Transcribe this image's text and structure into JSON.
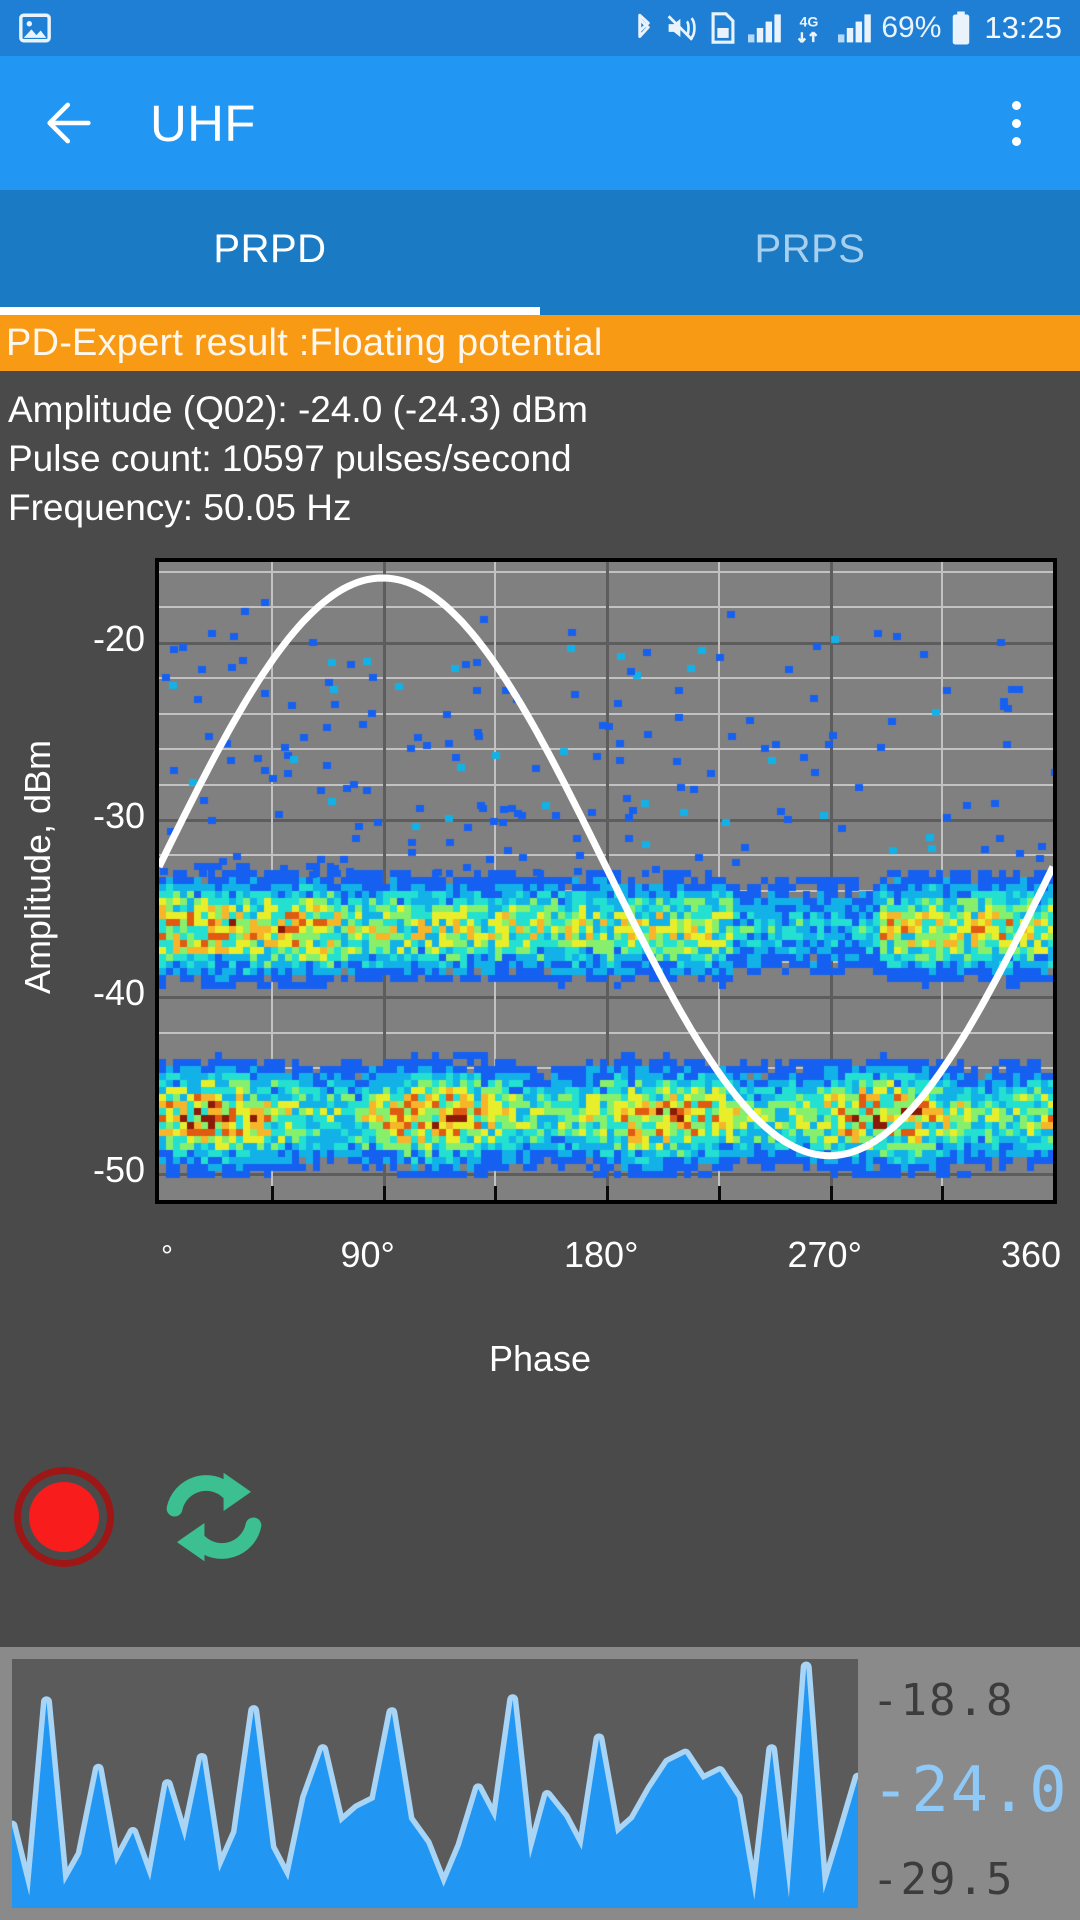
{
  "statusbar": {
    "icons_left": [
      "image-icon"
    ],
    "icons_right": [
      "bluetooth-icon",
      "mute-vibrate-icon",
      "sim-card-icon",
      "signal-bars-icon",
      "4g-data-icon",
      "signal-bars-2-icon"
    ],
    "network_label": "4G",
    "battery_percent": "69%",
    "clock": "13:25"
  },
  "appbar": {
    "back_label": "back-arrow",
    "title": "UHF",
    "overflow_label": "more-options"
  },
  "tabs": [
    {
      "label": "PRPD",
      "active": true
    },
    {
      "label": "PRPS",
      "active": false
    }
  ],
  "banner": {
    "text": "PD-Expert result :Floating potential",
    "background": "#f99a14",
    "color": "#fdf7ef"
  },
  "info": {
    "amplitude": "Amplitude (Q02): -24.0 (-24.3) dBm",
    "pulse_count": "Pulse count: 10597 pulses/second",
    "frequency": "Frequency: 50.05 Hz"
  },
  "chart_data": {
    "type": "scatter",
    "title": "",
    "xlabel": "Phase",
    "ylabel": "Amplitude, dBm",
    "xlim": [
      0,
      360
    ],
    "ylim": [
      -51.5,
      -15.5
    ],
    "xticks": [
      0,
      90,
      180,
      270,
      360
    ],
    "xtick_labels": [
      "°",
      "90°",
      "180°",
      "270°",
      "360"
    ],
    "yticks": [
      -20,
      -30,
      -40,
      -50
    ],
    "ytick_labels": [
      "-20",
      "-30",
      "-40",
      "-50"
    ],
    "y_minor_step": 2,
    "grid": true,
    "plot_background": "#808080",
    "grid_color": "#c2c2c2",
    "major_grid_color": "#5d5d5d",
    "reference_curve": {
      "name": "phase reference sine",
      "color": "#ffffff",
      "amplitude_dbm_peak": -16.4,
      "amplitude_dbm_trough": -49.0,
      "phase_offset_deg": 0,
      "cycles": 1
    },
    "density_colormap": [
      "#1034a6",
      "#1560f0",
      "#12b2e8",
      "#24e0d0",
      "#86f06c",
      "#e8ef2a",
      "#f7b52a",
      "#e05a12",
      "#8b1a08"
    ],
    "bands": [
      {
        "name": "sparse upper scatter",
        "y_range": [
          -32,
          -17
        ],
        "density": "sparse",
        "dominant_color": "#1560d8"
      },
      {
        "name": "mid dense band",
        "y_range": [
          -40,
          -32
        ],
        "density": "dense",
        "dominant_color": "#24d8e0"
      },
      {
        "name": "lower dense band",
        "y_range": [
          -50,
          -43
        ],
        "density": "very dense",
        "dominant_color": "#9ff040"
      }
    ]
  },
  "controls": {
    "record_button": "record-button",
    "record_color": "#f91c1c",
    "refresh_button": "refresh-button",
    "refresh_color": "#3cbf91"
  },
  "waveform": {
    "max_label": "-18.8",
    "current_label": "-24.0",
    "min_label": "-29.5",
    "fill_color": "#2196f3",
    "stroke_color": "#a8d4f5",
    "background": "#5b5b5b",
    "panel_background": "#8a8a8a",
    "values": [
      -26.1,
      -29.3,
      -20.4,
      -28.8,
      -27.4,
      -23.5,
      -27.9,
      -26.4,
      -28.6,
      -24.2,
      -26.8,
      -23.0,
      -28.2,
      -26.4,
      -20.8,
      -27.1,
      -28.6,
      -24.8,
      -22.6,
      -26.0,
      -25.3,
      -24.9,
      -20.9,
      -25.8,
      -26.9,
      -28.9,
      -27.0,
      -24.4,
      -25.9,
      -20.3,
      -27.6,
      -24.7,
      -25.7,
      -27.2,
      -22.1,
      -26.5,
      -25.8,
      -24.4,
      -23.2,
      -22.8,
      -24.0,
      -23.6,
      -24.8,
      -29.5,
      -22.6,
      -29.4,
      -18.8,
      -29.2,
      -26.6,
      -23.9
    ]
  }
}
